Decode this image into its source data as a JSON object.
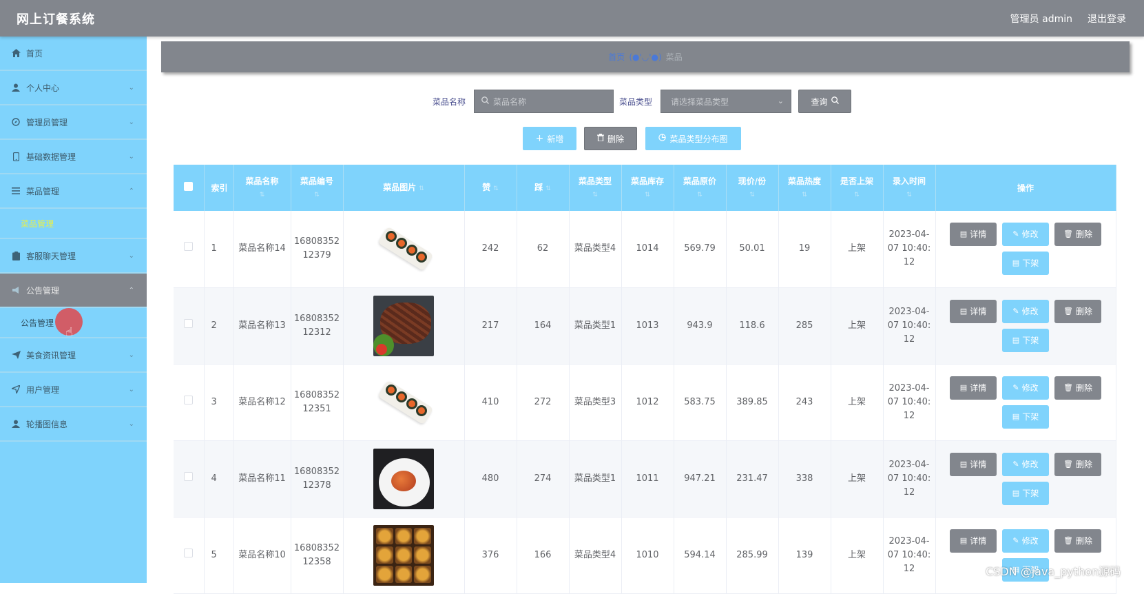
{
  "header": {
    "title": "网上订餐系统",
    "user_label": "管理员 admin",
    "logout_label": "退出登录"
  },
  "sidebar": {
    "items": [
      {
        "label": "首页",
        "icon": "home-icon"
      },
      {
        "label": "个人中心",
        "icon": "user-icon"
      },
      {
        "label": "管理员管理",
        "icon": "compass-icon"
      },
      {
        "label": "基础数据管理",
        "icon": "phone-icon"
      },
      {
        "label": "菜品管理",
        "icon": "menu-icon"
      },
      {
        "label": "菜品管理",
        "icon": ""
      },
      {
        "label": "客服聊天管理",
        "icon": "clipboard-icon"
      },
      {
        "label": "公告管理",
        "icon": "notice-icon"
      },
      {
        "label": "公告管理",
        "icon": ""
      },
      {
        "label": "美食资讯管理",
        "icon": "send-icon"
      },
      {
        "label": "用户管理",
        "icon": "navigation-icon"
      },
      {
        "label": "轮播图信息",
        "icon": "user-icon"
      }
    ]
  },
  "breadcrumb": {
    "home": "首页",
    "separator": "(●'◡'●)",
    "current": "菜品"
  },
  "search": {
    "name_label": "菜品名称",
    "name_placeholder": "菜品名称",
    "type_label": "菜品类型",
    "type_placeholder": "请选择菜品类型",
    "query_label": "查询"
  },
  "actions": {
    "add_label": "新增",
    "delete_label": "删除",
    "chart_label": "菜品类型分布图"
  },
  "table": {
    "columns": [
      "索引",
      "菜品名称",
      "菜品编号",
      "菜品图片",
      "赞",
      "踩",
      "菜品类型",
      "菜品库存",
      "菜品原价",
      "现价/份",
      "菜品热度",
      "是否上架",
      "录入时间",
      "操作"
    ],
    "ops": {
      "detail": "详情",
      "edit": "修改",
      "delete": "删除",
      "off": "下架"
    },
    "rows": [
      {
        "index": "1",
        "name": "菜品名称14",
        "code_a": "16808352",
        "code_b": "12379",
        "image": "sushi",
        "like": "242",
        "dislike": "62",
        "type": "菜品类型4",
        "stock": "1014",
        "orig_price": "569.79",
        "price": "50.01",
        "heat": "19",
        "status": "上架",
        "time_a": "2023-04-",
        "time_b": "07 10:40:",
        "time_c": "12"
      },
      {
        "index": "2",
        "name": "菜品名称13",
        "code_a": "16808352",
        "code_b": "12312",
        "image": "steak",
        "like": "217",
        "dislike": "164",
        "type": "菜品类型1",
        "stock": "1013",
        "orig_price": "943.9",
        "price": "118.6",
        "heat": "285",
        "status": "上架",
        "time_a": "2023-04-",
        "time_b": "07 10:40:",
        "time_c": "12"
      },
      {
        "index": "3",
        "name": "菜品名称12",
        "code_a": "16808352",
        "code_b": "12351",
        "image": "sushi",
        "like": "410",
        "dislike": "272",
        "type": "菜品类型3",
        "stock": "1012",
        "orig_price": "583.75",
        "price": "389.85",
        "heat": "243",
        "status": "上架",
        "time_a": "2023-04-",
        "time_b": "07 10:40:",
        "time_c": "12"
      },
      {
        "index": "4",
        "name": "菜品名称11",
        "code_a": "16808352",
        "code_b": "12378",
        "image": "plate",
        "like": "480",
        "dislike": "274",
        "type": "菜品类型1",
        "stock": "1011",
        "orig_price": "947.21",
        "price": "231.47",
        "heat": "338",
        "status": "上架",
        "time_a": "2023-04-",
        "time_b": "07 10:40:",
        "time_c": "12"
      },
      {
        "index": "5",
        "name": "菜品名称10",
        "code_a": "16808352",
        "code_b": "12358",
        "image": "box",
        "like": "376",
        "dislike": "166",
        "type": "菜品类型4",
        "stock": "1010",
        "orig_price": "594.14",
        "price": "285.99",
        "heat": "139",
        "status": "上架",
        "time_a": "2023-04-",
        "time_b": "07 10:40:",
        "time_c": "12"
      }
    ]
  },
  "watermark": "CSDN @java_python源码",
  "colors": {
    "header_bg": "#82868d",
    "sidebar_bg": "#7fd3fc",
    "accent_blue": "#7fd3fc",
    "button_gray": "#82868d"
  }
}
